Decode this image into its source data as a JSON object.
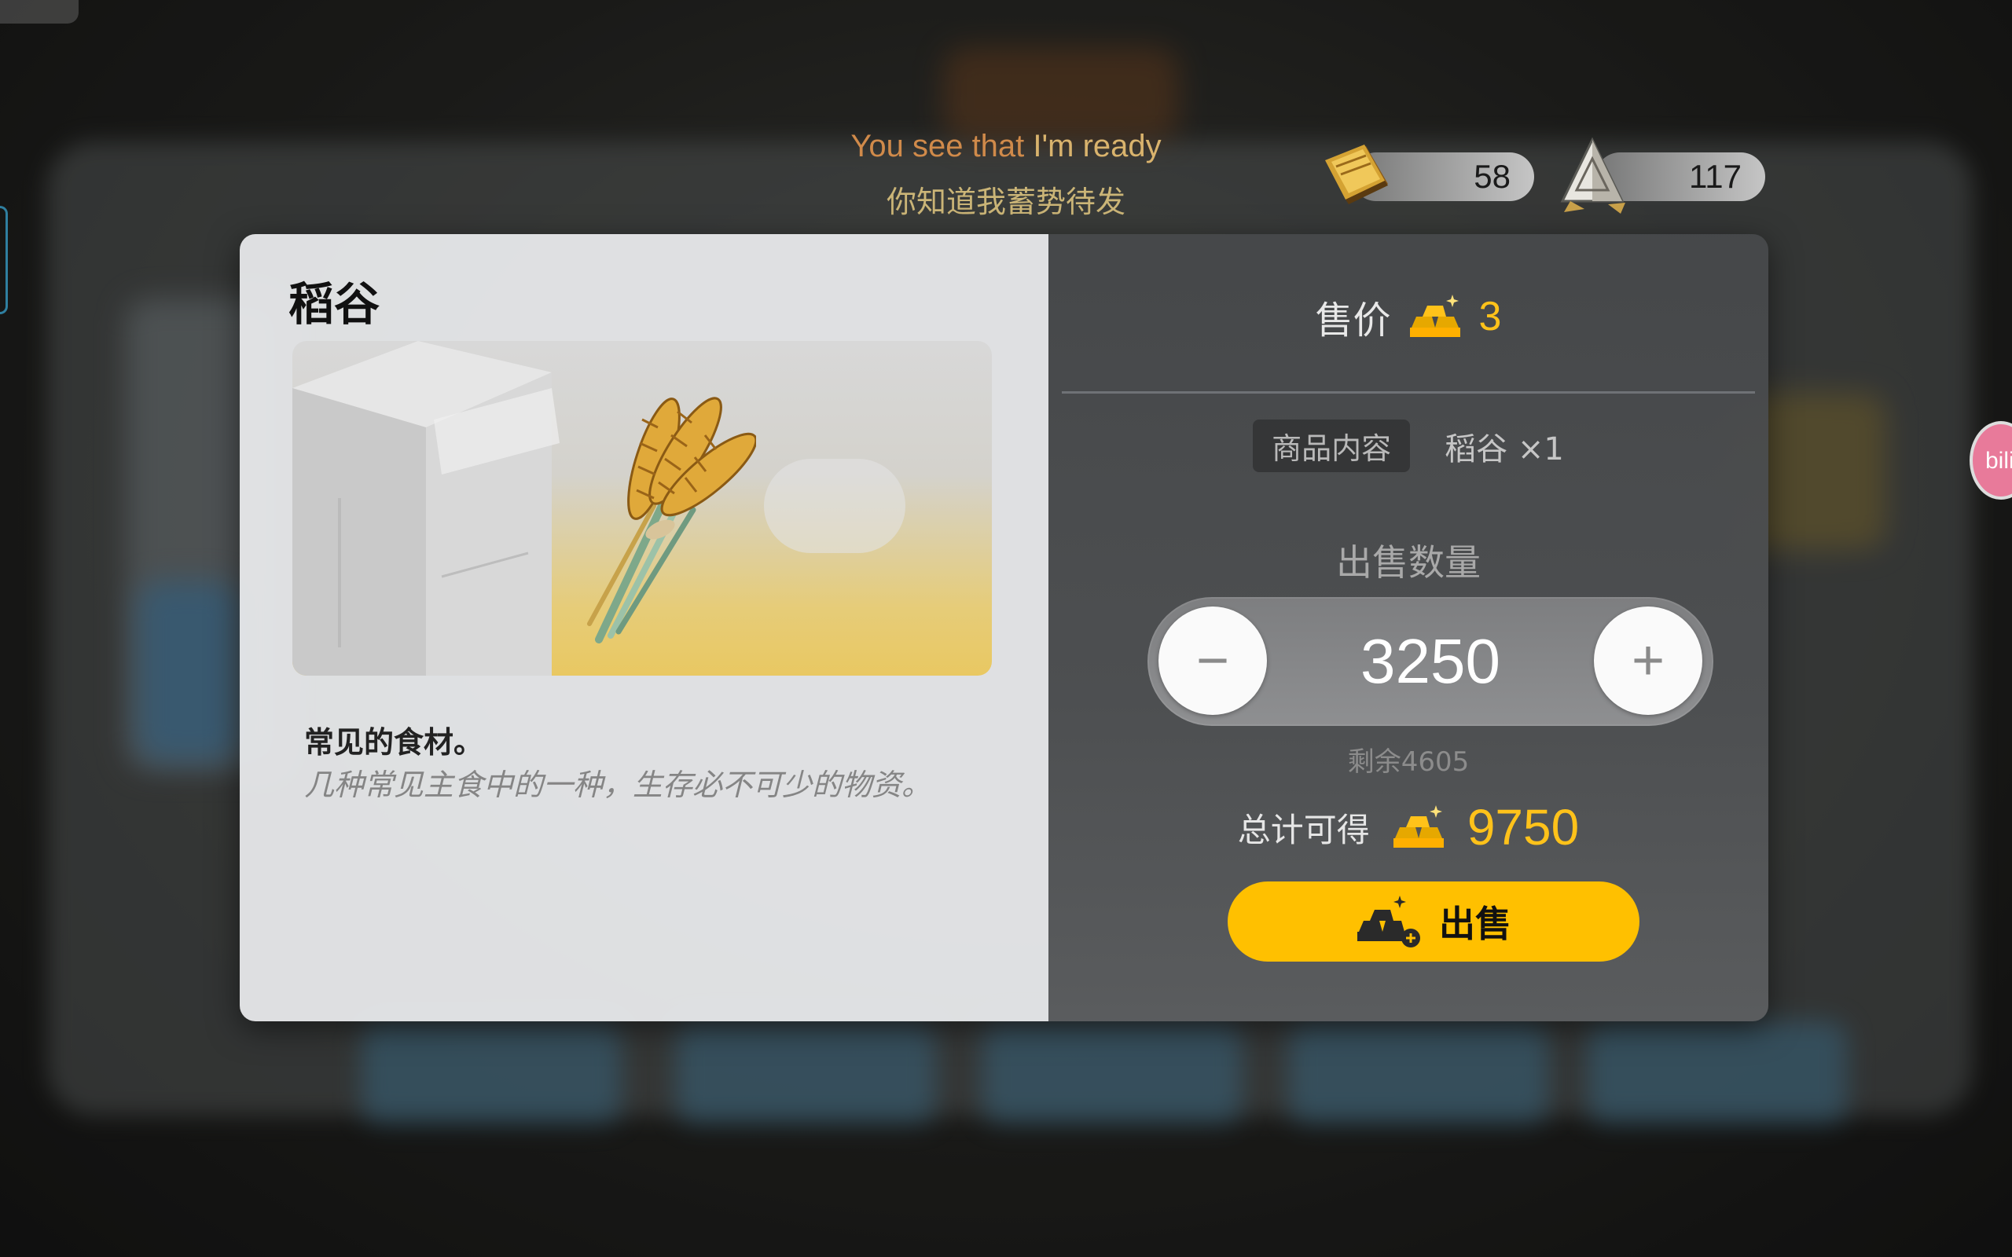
{
  "subtitle": {
    "en_part1": "You see that ",
    "en_part2": "I'm ready",
    "cn": "你知道我蓄势待发"
  },
  "currencies": [
    {
      "icon": "gold-book-icon",
      "value": "58"
    },
    {
      "icon": "crystal-pyramid-icon",
      "value": "117"
    }
  ],
  "item": {
    "name": "稻谷",
    "image": "wheat-bundle-icon",
    "description": "常见的食材。",
    "flavor": "几种常见主食中的一种，生存必不可少的物资。"
  },
  "sale": {
    "price_label": "售价",
    "price_value": "3",
    "content_label": "商品内容",
    "content_value": "稻谷 ×1",
    "quantity_label": "出售数量",
    "quantity": "3250",
    "minus_label": "−",
    "plus_label": "+",
    "remaining": "剩余4605",
    "total_label": "总计可得",
    "total_value": "9750",
    "sell_button": "出售"
  },
  "side_badge": "bili",
  "colors": {
    "accent_gold": "#ffc21a",
    "sell_button": "#ffc000"
  }
}
